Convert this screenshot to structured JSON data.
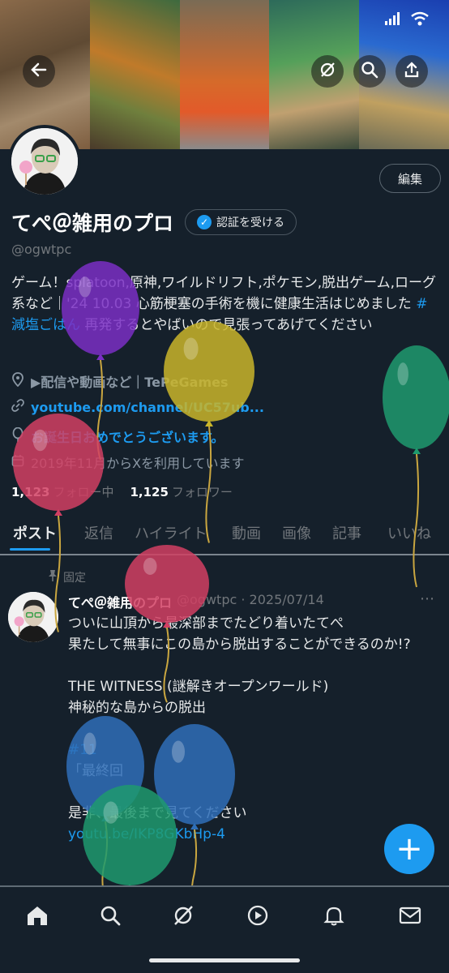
{
  "status_bar": {
    "signal_icon": "signal-icon",
    "wifi_icon": "wifi-icon"
  },
  "header": {
    "back_icon": "arrow-left-icon",
    "grok_icon": "slash-circle-icon",
    "search_icon": "search-icon",
    "share_icon": "share-icon"
  },
  "profile": {
    "edit_label": "編集",
    "display_name": "てぺ＠雑用のプロ",
    "verify_label": "認証を受ける",
    "handle": "@ogwtpc",
    "bio_before_tag": "ゲーム！splatoon,原神,ワイルドリフト,ポケモン,脱出ゲーム,ローグ系など｜'24 10.03 心筋梗塞の手術を機に健康生活はじめました ",
    "bio_hashtag": "#減塩ごはん",
    "bio_after_tag": " 再発するとやばいので見張ってあげてください",
    "location": "▶配信や動画など｜TePeGames",
    "website": "youtube.com/channel/UC57ub...",
    "birthday": "お誕生日おめでとうございます。",
    "joined": "2019年11月からXを利用しています",
    "following_count": "1,123",
    "following_label": "フォロー中",
    "followers_count": "1,125",
    "followers_label": "フォロワー"
  },
  "tabs": [
    {
      "label": "ポスト",
      "active": true
    },
    {
      "label": "返信"
    },
    {
      "label": "ハイライト"
    },
    {
      "label": "動画"
    },
    {
      "label": "画像"
    },
    {
      "label": "記事"
    },
    {
      "label": "いいね"
    }
  ],
  "post": {
    "pinned_label": "固定",
    "author_name": "てぺ＠雑用のプロ",
    "author_meta": "@ogwtpc · 2025/07/14",
    "lines": [
      "ついに山頂から最深部までたどり着いたてぺ",
      "果たして無事にこの島から脱出することができるのか!?",
      "",
      "THE WITNESS (謎解きオープンワールド)",
      "神秘的な島からの脱出",
      ""
    ],
    "hashtag": "#11",
    "episode": "「最終回",
    "closing": "是非、最後まで見てください",
    "link": "youtu.be/IKP8GKbHp-4"
  },
  "fab": {
    "icon": "plus-icon"
  },
  "bottom_nav": [
    "home-icon",
    "search-icon",
    "grok-icon",
    "play-icon",
    "bell-icon",
    "mail-icon"
  ],
  "balloon_colors": [
    "#7a2fc4",
    "#c9b52a",
    "#1e9a6e",
    "#d13f63",
    "#d13f63",
    "#2f6fb8",
    "#2f6fb8",
    "#1e9a6e"
  ]
}
